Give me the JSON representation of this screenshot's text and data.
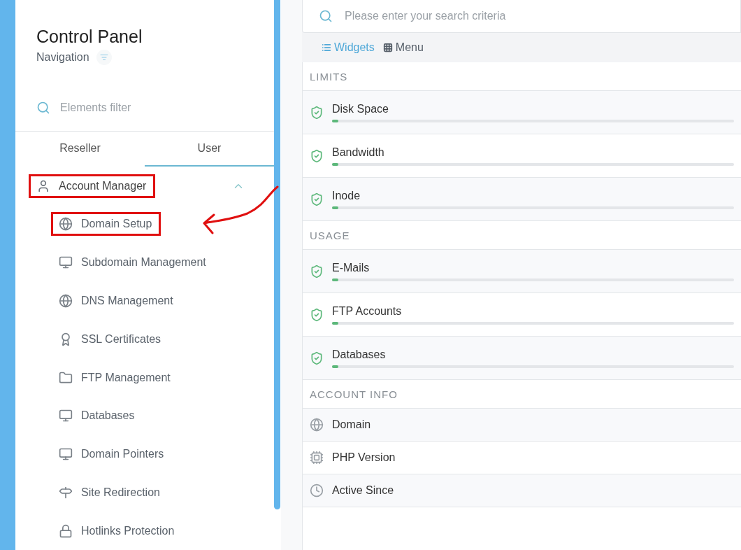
{
  "sidebar": {
    "title": "Control Panel",
    "subtitle": "Navigation",
    "filter": {
      "placeholder": "Elements filter"
    },
    "tabs": [
      {
        "label": "Reseller",
        "selected": false
      },
      {
        "label": "User",
        "selected": true
      }
    ],
    "menu": [
      {
        "label": "Account Manager",
        "expanded": true,
        "highlighted": true,
        "children": [
          {
            "label": "Domain Setup",
            "highlighted": true
          },
          {
            "label": "Subdomain Management",
            "highlighted": false
          },
          {
            "label": "DNS Management",
            "highlighted": false
          },
          {
            "label": "SSL Certificates",
            "highlighted": false
          },
          {
            "label": "FTP Management",
            "highlighted": false
          },
          {
            "label": "Databases",
            "highlighted": false
          },
          {
            "label": "Domain Pointers",
            "highlighted": false
          },
          {
            "label": "Site Redirection",
            "highlighted": false
          },
          {
            "label": "Hotlinks Protection",
            "highlighted": false
          }
        ]
      }
    ]
  },
  "main": {
    "search": {
      "placeholder": "Please enter your search criteria"
    },
    "views": [
      {
        "label": "Widgets",
        "selected": true
      },
      {
        "label": "Menu",
        "selected": false
      }
    ],
    "sections": [
      {
        "title": "LIMITS",
        "kind": "meters",
        "items": [
          {
            "label": "Disk Space",
            "level": 0.016
          },
          {
            "label": "Bandwidth",
            "level": 0.016
          },
          {
            "label": "Inode",
            "level": 0.016
          }
        ]
      },
      {
        "title": "USAGE",
        "kind": "meters",
        "items": [
          {
            "label": "E-Mails",
            "level": 0.016
          },
          {
            "label": "FTP Accounts",
            "level": 0.016
          },
          {
            "label": "Databases",
            "level": 0.016
          }
        ]
      },
      {
        "title": "ACCOUNT INFO",
        "kind": "info",
        "items": [
          {
            "label": "Domain"
          },
          {
            "label": "PHP Version"
          },
          {
            "label": "Active Since"
          }
        ]
      }
    ]
  }
}
